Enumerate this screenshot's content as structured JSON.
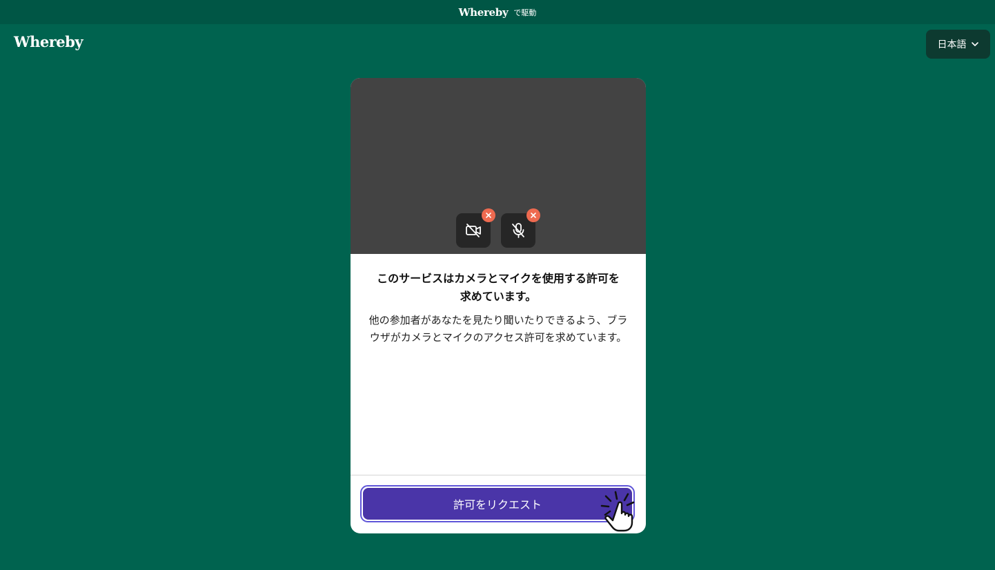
{
  "topbar": {
    "brand": "Whereby",
    "powered_by": "で駆動"
  },
  "header": {
    "logo": "Whereby",
    "language_button": "日本語"
  },
  "icons": {
    "camera": "camera-off-icon",
    "microphone": "mic-off-icon",
    "error": "close-icon",
    "language": "chevron-down-icon",
    "pointer": "hand-pointer-click-icon"
  },
  "colors": {
    "page_bg": "#00634f",
    "topbar_bg": "#005645",
    "preview_bg": "#434343",
    "error_badge": "#ee6a50",
    "button_bg": "#4a35a8"
  },
  "permission": {
    "title": "このサービスはカメラとマイクを使用する許可を求めています。",
    "body": "他の参加者があなたを見たり聞いたりできるよう、ブラウザがカメラとマイクのアクセス許可を求めています。",
    "request_button": "許可をリクエスト"
  }
}
